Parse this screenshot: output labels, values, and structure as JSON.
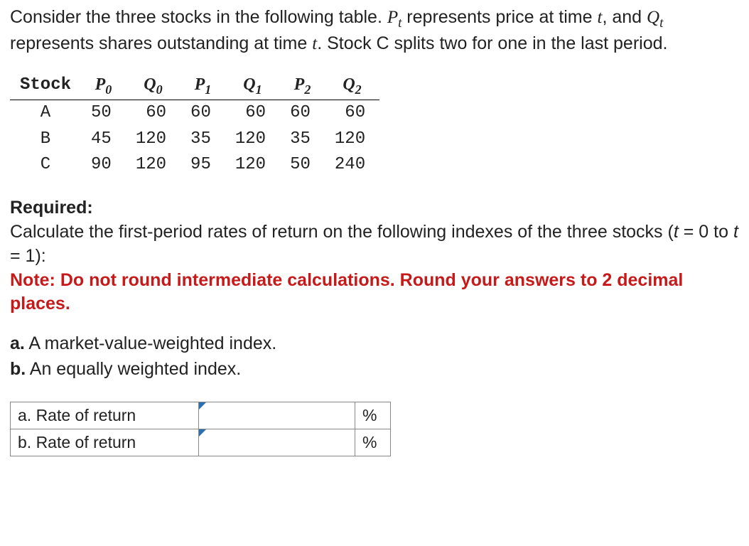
{
  "problem": {
    "line1_pre": "Consider the three stocks in the following table. ",
    "var_p": "P",
    "var_t": "t",
    "line1_mid": " represents price at time ",
    "italic_t": "t",
    "line1_post": ", and ",
    "var_q": "Q",
    "line2_mid": " represents shares outstanding at time ",
    "line2_post": ". Stock C splits two for one in the last period."
  },
  "data_table": {
    "headers": {
      "stock": "Stock",
      "P0_base": "P",
      "P0_sub": "0",
      "Q0_base": "Q",
      "Q0_sub": "0",
      "P1_base": "P",
      "P1_sub": "1",
      "Q1_base": "Q",
      "Q1_sub": "1",
      "P2_base": "P",
      "P2_sub": "2",
      "Q2_base": "Q",
      "Q2_sub": "2"
    },
    "rows": [
      {
        "stock": "A",
        "P0": "50",
        "Q0": "60",
        "P1": "60",
        "Q1": "60",
        "P2": "60",
        "Q2": "60"
      },
      {
        "stock": "B",
        "P0": "45",
        "Q0": "120",
        "P1": "35",
        "Q1": "120",
        "P2": "35",
        "Q2": "120"
      },
      {
        "stock": "C",
        "P0": "90",
        "Q0": "120",
        "P1": "95",
        "Q1": "120",
        "P2": "50",
        "Q2": "240"
      }
    ]
  },
  "required": {
    "label": "Required:",
    "text_pre": "Calculate the first-period rates of return on the following indexes of the three stocks (",
    "t_eq_0": "t ",
    "eq0": "= 0 to ",
    "t_eq_1": "t ",
    "eq1": "= 1):",
    "note": "Note: Do not round intermediate calculations. Round your answers to 2 decimal places."
  },
  "parts": {
    "a_label": "a.",
    "a_text": " A market-value-weighted index.",
    "b_label": "b.",
    "b_text": " An equally weighted index."
  },
  "answers": {
    "a_label": "a. Rate of return",
    "b_label": "b. Rate of return",
    "unit": "%",
    "a_value": "",
    "b_value": ""
  }
}
